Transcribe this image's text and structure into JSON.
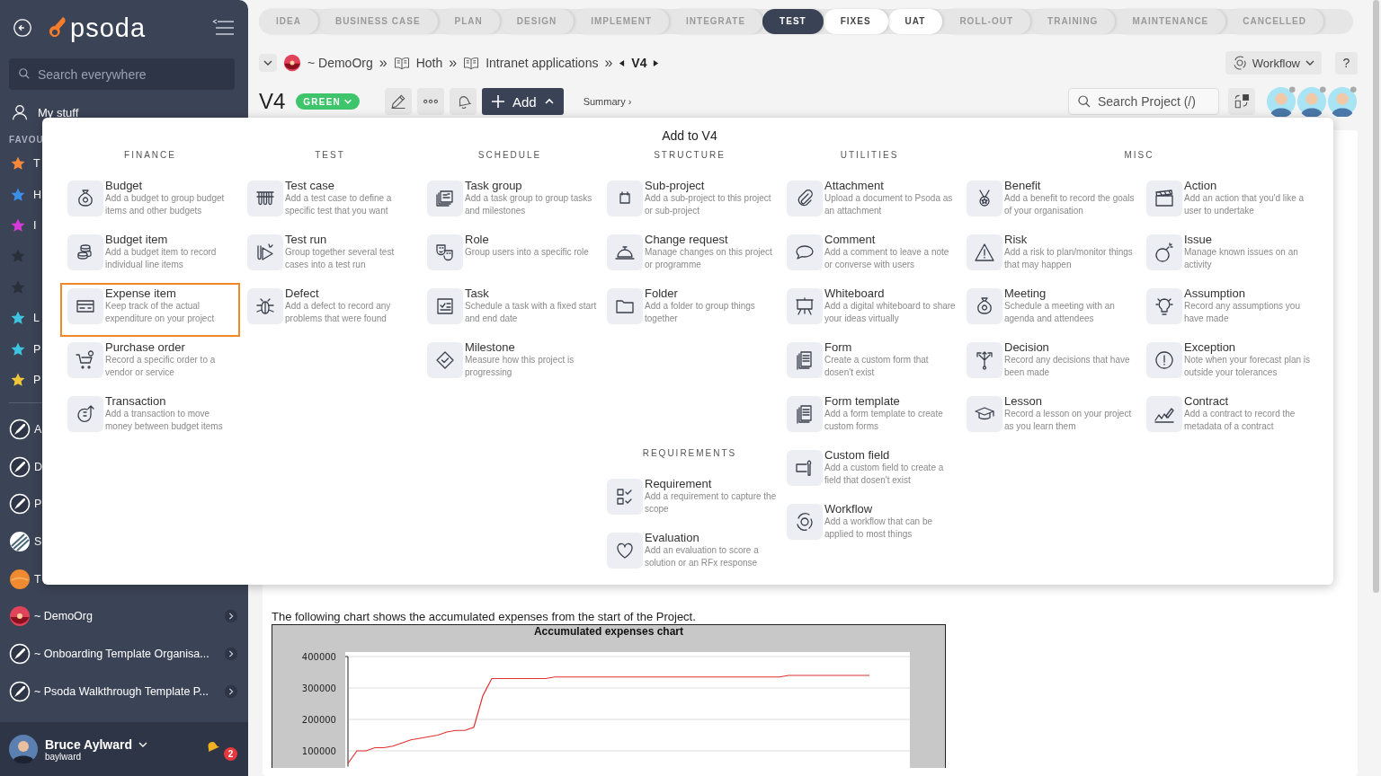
{
  "sidebar": {
    "logo": "psoda",
    "search": {
      "placeholder": "Search everywhere"
    },
    "my_stuff": "My stuff",
    "favourites_heading": "FAVOU",
    "favourites": [
      {
        "label": "T",
        "color": "#f5893a"
      },
      {
        "label": "H",
        "color": "#3b8ee8"
      },
      {
        "label": "I",
        "color": "#d63ad6"
      },
      {
        "color": "#2b2f3a"
      },
      {
        "color": "#2b2f3a"
      },
      {
        "label": "L",
        "color": "#3cc4e0"
      },
      {
        "label": "P",
        "color": "#3cc4e0"
      },
      {
        "label": "P",
        "color": "#f0c63a"
      }
    ],
    "projects": [
      {
        "label": "A",
        "kind": "rocket",
        "expandable": false
      },
      {
        "label": "D",
        "kind": "rocket",
        "expandable": false
      },
      {
        "label": "P",
        "kind": "rocket",
        "expandable": false
      },
      {
        "label": "S",
        "kind": "stripes",
        "expandable": false
      },
      {
        "label": "T",
        "kind": "sun",
        "expandable": false
      },
      {
        "label": "~ DemoOrg",
        "kind": "sunset",
        "expandable": true
      },
      {
        "label": "~ Onboarding Template Organisa...",
        "kind": "rocket",
        "expandable": true
      },
      {
        "label": "~ Psoda Walkthrough Template P...",
        "kind": "rocket",
        "expandable": true
      }
    ],
    "user": {
      "name": "Bruce Aylward",
      "username": "baylward",
      "notifications": "2"
    }
  },
  "stages": [
    {
      "label": "IDEA",
      "selected": false,
      "highlighted": false
    },
    {
      "label": "BUSINESS CASE",
      "selected": false,
      "highlighted": false
    },
    {
      "label": "PLAN",
      "selected": false,
      "highlighted": false
    },
    {
      "label": "DESIGN",
      "selected": false,
      "highlighted": false
    },
    {
      "label": "IMPLEMENT",
      "selected": false,
      "highlighted": false
    },
    {
      "label": "INTEGRATE",
      "selected": false,
      "highlighted": false
    },
    {
      "label": "TEST",
      "selected": true,
      "highlighted": false
    },
    {
      "label": "FIXES",
      "selected": false,
      "highlighted": true
    },
    {
      "label": "UAT",
      "selected": false,
      "highlighted": true
    },
    {
      "label": "ROLL-OUT",
      "selected": false,
      "highlighted": false
    },
    {
      "label": "TRAINING",
      "selected": false,
      "highlighted": false
    },
    {
      "label": "MAINTENANCE",
      "selected": false,
      "highlighted": false
    },
    {
      "label": "CANCELLED",
      "selected": false,
      "highlighted": false
    }
  ],
  "breadcrumb": [
    {
      "kind": "org",
      "label": "~ DemoOrg"
    },
    {
      "kind": "separator",
      "label": "»"
    },
    {
      "kind": "book",
      "label": "Hoth"
    },
    {
      "kind": "separator",
      "label": "»"
    },
    {
      "kind": "book",
      "label": "Intranet applications"
    },
    {
      "kind": "separator",
      "label": "»"
    },
    {
      "kind": "current",
      "label": "V4"
    }
  ],
  "workflow_button": "Workflow",
  "help_button": "?",
  "title": "V4",
  "status": "GREEN",
  "add_button": "Add",
  "summary_link": "Summary ›",
  "project_search": {
    "placeholder": "Search Project (/)"
  },
  "menu": {
    "title": "Add to V4",
    "groups": [
      {
        "sections": [
          {
            "heading": "FINANCE",
            "columns": [
              [
                {
                  "title": "Budget",
                  "description": "Add a budget to group budget items and other budgets",
                  "selected": false
                },
                {
                  "title": "Budget item",
                  "description": "Add a budget item to record individual line items",
                  "selected": false
                },
                {
                  "title": "Expense item",
                  "description": "Keep track of the actual expenditure on your project",
                  "selected": true
                },
                {
                  "title": "Purchase order",
                  "description": "Record a specific order to a vendor or service",
                  "selected": false
                },
                {
                  "title": "Transaction",
                  "description": "Add a transaction to move money between budget items",
                  "selected": false
                }
              ]
            ]
          }
        ]
      },
      {
        "sections": [
          {
            "heading": "TEST",
            "columns": [
              [
                {
                  "title": "Test case",
                  "description": "Add a test case to define a specific test that you want",
                  "selected": false
                },
                {
                  "title": "Test run",
                  "description": "Group together several test cases into a test run",
                  "selected": false
                },
                {
                  "title": "Defect",
                  "description": "Add a defect to record any problems that were found",
                  "selected": false
                }
              ]
            ]
          }
        ]
      },
      {
        "sections": [
          {
            "heading": "SCHEDULE",
            "columns": [
              [
                {
                  "title": "Task group",
                  "description": "Add a task group to group tasks and milestones",
                  "selected": false
                },
                {
                  "title": "Role",
                  "description": "Group users into a specific role",
                  "selected": false
                },
                {
                  "title": "Task",
                  "description": "Schedule a task with a fixed start and end date",
                  "selected": false
                },
                {
                  "title": "Milestone",
                  "description": "Measure how this project is progressing",
                  "selected": false
                }
              ]
            ]
          }
        ]
      },
      {
        "sections": [
          {
            "heading": "STRUCTURE",
            "columns": [
              [
                {
                  "title": "Sub-project",
                  "description": "Add a sub-project to this project or sub-project",
                  "selected": false
                },
                {
                  "title": "Change request",
                  "description": "Manage changes on this project or programme",
                  "selected": false
                },
                {
                  "title": "Folder",
                  "description": "Add a folder to group things together",
                  "selected": false
                }
              ]
            ]
          },
          {
            "heading": "REQUIREMENTS",
            "columns": [
              [
                {
                  "title": "Requirement",
                  "description": "Add a requirement to capture the scope",
                  "selected": false
                },
                {
                  "title": "Evaluation",
                  "description": "Add an evaluation to score a solution or an RFx response",
                  "selected": false
                }
              ]
            ]
          }
        ]
      },
      {
        "sections": [
          {
            "heading": "UTILITIES",
            "columns": [
              [
                {
                  "title": "Attachment",
                  "description": "Upload a document to Psoda as an attachment",
                  "selected": false
                },
                {
                  "title": "Comment",
                  "description": "Add a comment to leave a note or converse with users",
                  "selected": false
                },
                {
                  "title": "Whiteboard",
                  "description": "Add a digital whiteboard to share your ideas virtually",
                  "selected": false
                },
                {
                  "title": "Form",
                  "description": "Create a custom form that dosen't exist",
                  "selected": false
                },
                {
                  "title": "Form template",
                  "description": "Add a form template to create custom forms",
                  "selected": false
                },
                {
                  "title": "Custom field",
                  "description": "Add a custom field to create a field that dosen't exist",
                  "selected": false
                },
                {
                  "title": "Workflow",
                  "description": "Add a workflow that can be applied to most things",
                  "selected": false
                }
              ]
            ]
          }
        ]
      },
      {
        "sections": [
          {
            "heading": "MISC",
            "columns": [
              [
                {
                  "title": "Benefit",
                  "description": "Add a benefit to record the goals of your organisation",
                  "selected": false
                },
                {
                  "title": "Risk",
                  "description": "Add a risk to plan/monitor things that may happen",
                  "selected": false
                },
                {
                  "title": "Meeting",
                  "description": "Schedule a meeting with an agenda and attendees",
                  "selected": false
                },
                {
                  "title": "Decision",
                  "description": "Record any decisions that have been made",
                  "selected": false
                },
                {
                  "title": "Lesson",
                  "description": "Record a lesson on your project as you learn them",
                  "selected": false
                }
              ],
              [
                {
                  "title": "Action",
                  "description": "Add an action that you'd like a user to undertake",
                  "selected": false
                },
                {
                  "title": "Issue",
                  "description": "Manage known issues on an activity",
                  "selected": false
                },
                {
                  "title": "Assumption",
                  "description": "Record any assumptions you have made",
                  "selected": false
                },
                {
                  "title": "Exception",
                  "description": "Note when your forecast plan is outside your tolerances",
                  "selected": false
                },
                {
                  "title": "Contract",
                  "description": "Add a contract to record the metadata of a contract",
                  "selected": false
                }
              ]
            ]
          }
        ]
      }
    ]
  },
  "content": {
    "intro": "The following chart shows the accumulated expenses from the start of the Project.",
    "chart_data": {
      "type": "line",
      "title": "Accumulated expenses chart",
      "ylim": [
        50000,
        400000
      ],
      "yticks": [
        100000,
        200000,
        300000,
        400000
      ],
      "grid": true,
      "series": [
        {
          "color": "#e03030",
          "values": [
            60000,
            100000,
            100000,
            110000,
            110000,
            115000,
            125000,
            135000,
            140000,
            145000,
            150000,
            160000,
            165000,
            165000,
            175000,
            275000,
            330000,
            330000,
            330000,
            330000,
            330000,
            330000,
            330000,
            335000,
            335000,
            335000,
            335000,
            335000,
            335000,
            335000,
            335000,
            335000,
            335000,
            335000,
            335000,
            335000,
            335000,
            335000,
            335000,
            335000,
            335000,
            335000,
            335000,
            335000,
            335000,
            335000,
            335000,
            335000,
            335000,
            340000,
            340000,
            340000,
            340000,
            340000,
            340000,
            340000,
            340000,
            340000,
            340000
          ]
        }
      ]
    }
  }
}
